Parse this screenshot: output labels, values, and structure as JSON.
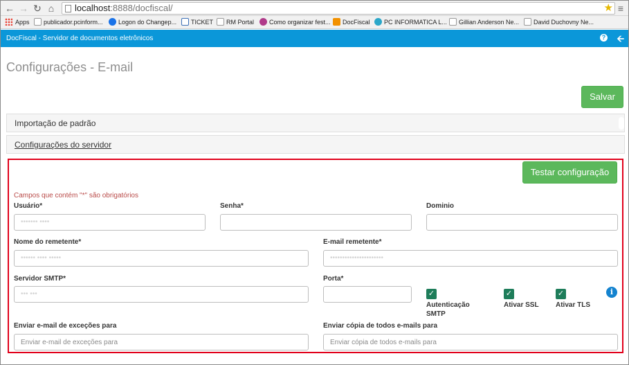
{
  "browser": {
    "url_host": "localhost",
    "url_path": ":8888/docfiscal/",
    "bookmarks": [
      {
        "label": "Apps",
        "color": "#e94235"
      },
      {
        "label": "publicador.pcinform...",
        "color": ""
      },
      {
        "label": "Logon do Changep...",
        "color": "#1a73e8"
      },
      {
        "label": "TICKET",
        "color": "#3b6fb6"
      },
      {
        "label": "RM Portal",
        "color": ""
      },
      {
        "label": "Como organizar fest...",
        "color": "#b03a8a"
      },
      {
        "label": "DocFiscal",
        "color": "#f29100"
      },
      {
        "label": "PC INFORMATICA L...",
        "color": "#2aa7c9"
      },
      {
        "label": "Gillian Anderson Ne...",
        "color": ""
      },
      {
        "label": "David Duchovny Ne...",
        "color": ""
      }
    ]
  },
  "appbar": {
    "title": "DocFiscal - Servidor de documentos eletrônicos",
    "color": "#0b97d9"
  },
  "page": {
    "title": "Configurações - E-mail",
    "save_label": "Salvar"
  },
  "panels": [
    {
      "label": "Importação de padrão"
    },
    {
      "label": "Configurações do servidor"
    }
  ],
  "form": {
    "test_label": "Testar configuração",
    "required_note": "Campos que contém \"*\" são obrigatórios",
    "usuario": {
      "label": "Usuário*",
      "value": "••••••• ••••"
    },
    "senha": {
      "label": "Senha*",
      "value": ""
    },
    "dominio": {
      "label": "Dominio",
      "value": ""
    },
    "nome_remetente": {
      "label": "Nome do remetente*",
      "value": "•••••• •••• •••••"
    },
    "email_remetente": {
      "label": "E-mail remetente*",
      "value": "••••••••••••••••••••••"
    },
    "servidor_smtp": {
      "label": "Servidor SMTP*",
      "value": "••• •••"
    },
    "porta": {
      "label": "Porta*",
      "value": ""
    },
    "autenticacao_smtp": {
      "label_1": "Autenticação",
      "label_2": "SMTP",
      "checked": true
    },
    "ativar_ssl": {
      "label": "Ativar SSL",
      "checked": true
    },
    "ativar_tls": {
      "label": "Ativar TLS",
      "checked": true
    },
    "excecoes": {
      "label": "Enviar e-mail de exceções para",
      "placeholder": "Enviar e-mail de exceções para"
    },
    "copia": {
      "label": "Enviar cópia de todos e-mails para",
      "placeholder": "Enviar cópia de todos e-mails para"
    }
  },
  "colors": {
    "accent_green": "#5cb85c",
    "highlight_red": "#e1001a",
    "checkbox": "#1e7d5a"
  }
}
